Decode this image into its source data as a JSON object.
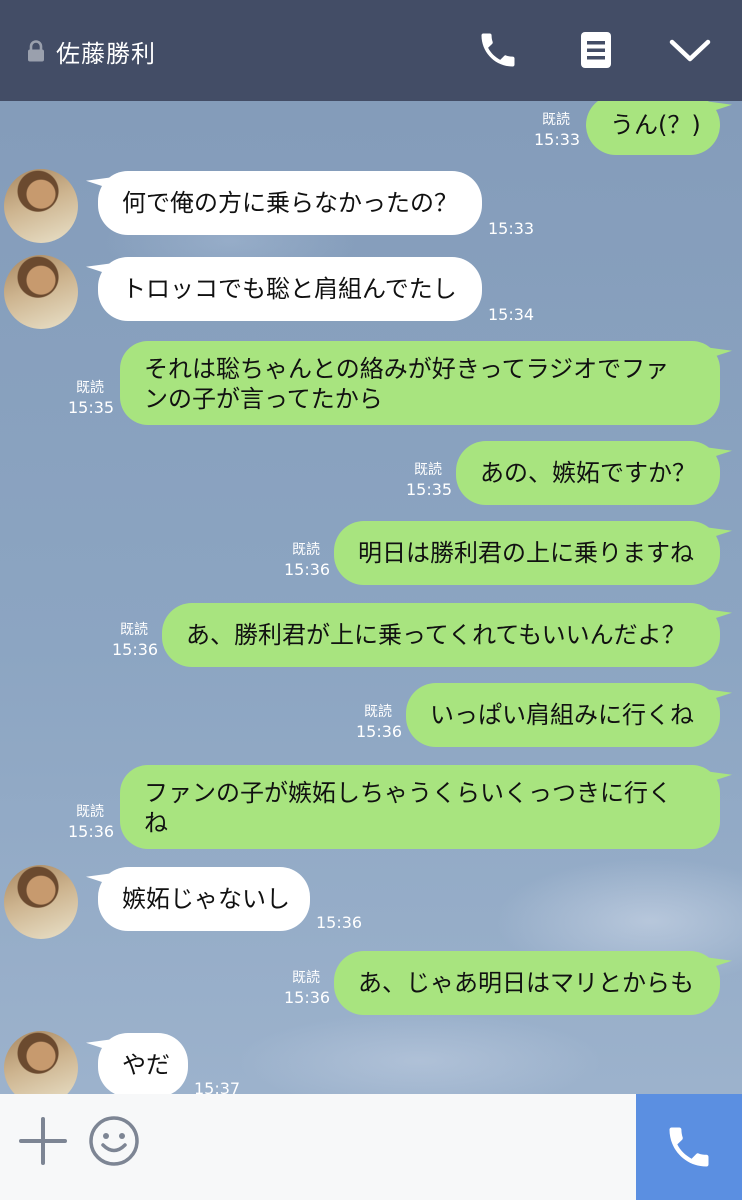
{
  "header": {
    "contact_name": "佐藤勝利"
  },
  "messages": [
    {
      "side": "sent",
      "text": "うん(？)",
      "read": "既読",
      "time": "15:33"
    },
    {
      "side": "recv",
      "text": "何で俺の方に乗らなかったの？",
      "time": "15:33"
    },
    {
      "side": "recv",
      "text": "トロッコでも聡と肩組んでたし",
      "time": "15:34"
    },
    {
      "side": "sent",
      "lines": [
        "それは聡ちゃんとの絡みが好きってラジオでファ",
        "ンの子が言ってたから"
      ],
      "read": "既読",
      "time": "15:35"
    },
    {
      "side": "sent",
      "text": "あの、嫉妬ですか？",
      "read": "既読",
      "time": "15:35"
    },
    {
      "side": "sent",
      "text": "明日は勝利君の上に乗りますね",
      "read": "既読",
      "time": "15:36"
    },
    {
      "side": "sent",
      "text": "あ、勝利君が上に乗ってくれてもいいんだよ？",
      "read": "既読",
      "time": "15:36"
    },
    {
      "side": "sent",
      "text": "いっぱい肩組みに行くね",
      "read": "既読",
      "time": "15:36"
    },
    {
      "side": "sent",
      "lines": [
        "ファンの子が嫉妬しちゃうくらいくっつきに行く",
        "ね"
      ],
      "read": "既読",
      "time": "15:36"
    },
    {
      "side": "recv",
      "text": "嫉妬じゃないし",
      "time": "15:36"
    },
    {
      "side": "sent",
      "text": "あ、じゃあ明日はマリとからも",
      "read": "既読",
      "time": "15:36"
    },
    {
      "side": "recv",
      "text": "やだ",
      "time": "15:37"
    }
  ],
  "colors": {
    "header_bg": "#434d66",
    "sent_bubble": "#a8e47f",
    "recv_bubble": "#ffffff",
    "call_button": "#5b8fe1"
  },
  "icons": {
    "lock": "lock-icon",
    "call": "phone-icon",
    "menu": "notes-icon",
    "collapse": "chevron-down-icon",
    "add": "plus-icon",
    "sticker": "smiley-icon"
  }
}
